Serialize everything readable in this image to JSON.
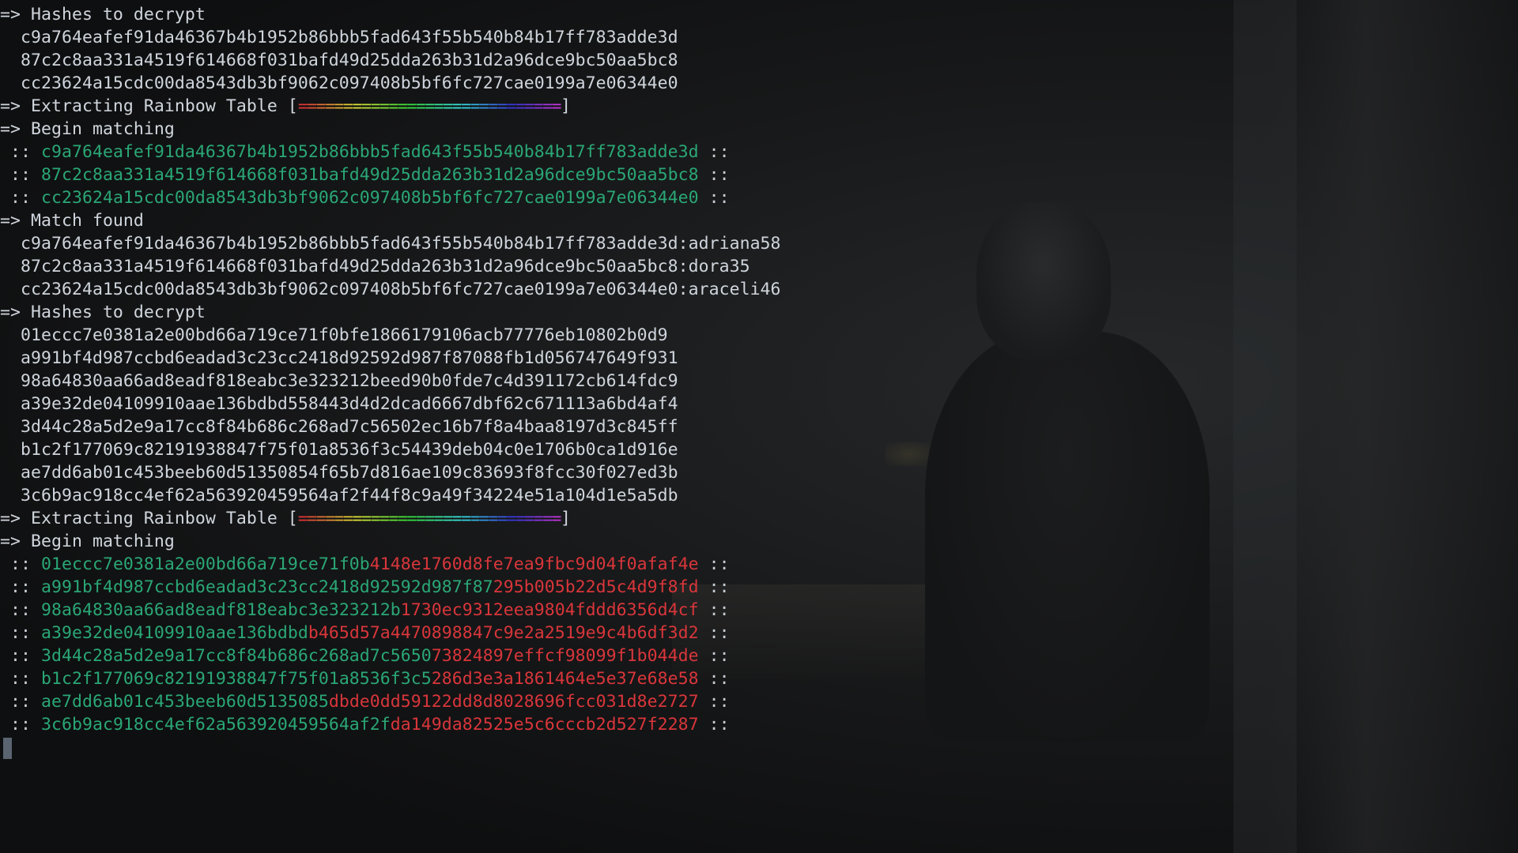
{
  "terminal": {
    "block1": {
      "hashes_heading": "=> Hashes to decrypt",
      "hashes": [
        "c9a764eafef91da46367b4b1952b86bbb5fad643f55b540b84b17ff783adde3d",
        "87c2c8aa331a4519f614668f031bafd49d25dda263b31d2a96dce9bc50aa5bc8",
        "cc23624a15cdc00da8543db3bf9062c097408b5bf6fc727cae0199a7e06344e0"
      ],
      "extract_heading": "=> Extracting Rainbow Table ",
      "progress_bar": "=============================",
      "progress_fraction": 1.0,
      "matching_heading": "=> Begin matching",
      "matching_rows": [
        {
          "green": "c9a764eafef91da46367b4b1952b86bbb5fad643f55b540b84b17ff783adde3d",
          "red": ""
        },
        {
          "green": "87c2c8aa331a4519f614668f031bafd49d25dda263b31d2a96dce9bc50aa5bc8",
          "red": ""
        },
        {
          "green": "cc23624a15cdc00da8543db3bf9062c097408b5bf6fc727cae0199a7e06344e0",
          "red": ""
        }
      ],
      "match_heading": "=> Match found",
      "matches": [
        "c9a764eafef91da46367b4b1952b86bbb5fad643f55b540b84b17ff783adde3d:adriana58",
        "87c2c8aa331a4519f614668f031bafd49d25dda263b31d2a96dce9bc50aa5bc8:dora35",
        "cc23624a15cdc00da8543db3bf9062c097408b5bf6fc727cae0199a7e06344e0:araceli46"
      ]
    },
    "block2": {
      "hashes_heading": "=> Hashes to decrypt",
      "hashes": [
        "01eccc7e0381a2e00bd66a719ce71f0bfe1866179106acb77776eb10802b0d9",
        "a991bf4d987ccbd6eadad3c23cc2418d92592d987f87088fb1d056747649f931",
        "98a64830aa66ad8eadf818eabc3e323212beed90b0fde7c4d391172cb614fdc9",
        "a39e32de04109910aae136bdbd558443d4d2dcad6667dbf62c671113a6bd4af4",
        "3d44c28a5d2e9a17cc8f84b686c268ad7c56502ec16b7f8a4baa8197d3c845ff",
        "b1c2f177069c82191938847f75f01a8536f3c54439deb04c0e1706b0ca1d916e",
        "ae7dd6ab01c453beeb60d51350854f65b7d816ae109c83693f8fcc30f027ed3b",
        "3c6b9ac918cc4ef62a563920459564af2f44f8c9a49f34224e51a104d1e5a5db"
      ],
      "extract_heading": "=> Extracting Rainbow Table ",
      "progress_bar": "=============================",
      "progress_fraction": 1.0,
      "matching_heading": "=> Begin matching",
      "matching_rows": [
        {
          "green": "01eccc7e0381a2e00bd66a719ce71f0b",
          "red": "4148e1760d8fe7ea9fbc9d04f0afaf4e"
        },
        {
          "green": "a991bf4d987ccbd6eadad3c23cc2418d92592d987f87",
          "red": "295b005b22d5c4d9f8fd"
        },
        {
          "green": "98a64830aa66ad8eadf818eabc3e323212b",
          "red": "1730ec9312eea9804fddd6356d4cf"
        },
        {
          "green": "a39e32de04109910aae136bdbd",
          "red": "b465d57a4470898847c9e2a2519e9c4b6df3d2"
        },
        {
          "green": "3d44c28a5d2e9a17cc8f84b686c268ad7c5650",
          "red": "73824897effcf98099f1b044de"
        },
        {
          "green": "b1c2f177069c82191938847f75f01a8536f3c5",
          "red": "286d3e3a1861464e5e37e68e58"
        },
        {
          "green": "ae7dd6ab01c453beeb60d5135085",
          "red": "dbde0dd59122dd8d8028696fcc031d8e2727"
        },
        {
          "green": "3c6b9ac918cc4ef62a563920459564af2f",
          "red": "da149da82525e5c6cccb2d527f2287"
        }
      ]
    },
    "row_prefix": " :: ",
    "row_suffix": " ::",
    "bracket_open": "[",
    "bracket_close": "]",
    "colors": {
      "background": "#121314",
      "text": "#cfd5dc",
      "match_green": "#2aa776",
      "mismatch_red": "#d9363b",
      "rainbow_start": "#e04848",
      "rainbow_end": "#b040e0"
    }
  }
}
